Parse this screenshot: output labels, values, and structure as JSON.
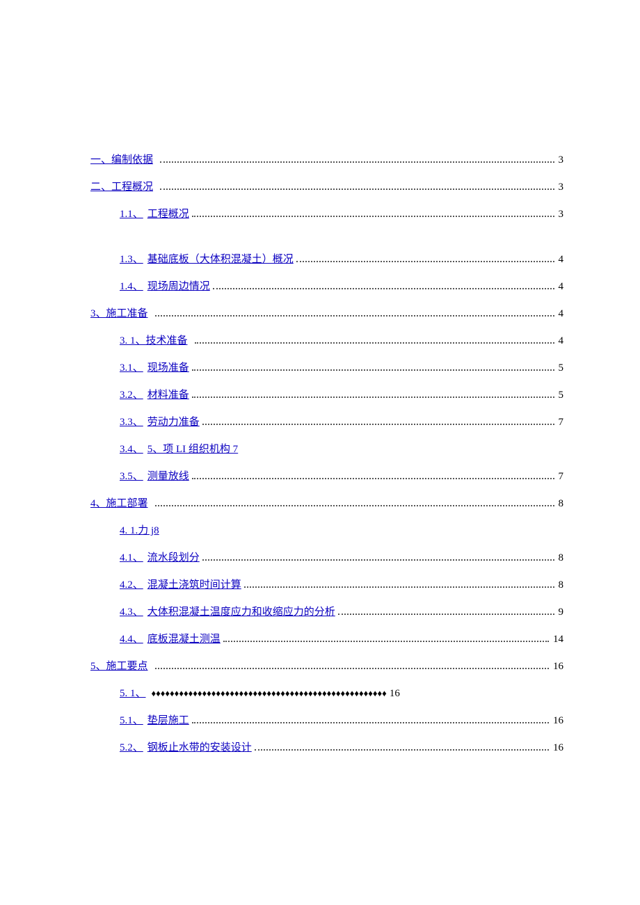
{
  "toc": {
    "items": [
      {
        "label": "一、编制依据",
        "suffix": "",
        "page": "3",
        "indent": false,
        "leader": "dots"
      },
      {
        "label": "二、工程概况",
        "suffix": "",
        "page": "3",
        "indent": false,
        "leader": "dots"
      },
      {
        "label": "1.1、",
        "suffix": "工程概况",
        "page": "3",
        "indent": true,
        "leader": "dots"
      },
      {
        "label": "1.3、",
        "suffix": "基础底板（大体积混凝土）概况",
        "page": "4",
        "indent": true,
        "leader": "dots",
        "space_before": true
      },
      {
        "label": "1.4、",
        "suffix": "现场周边情况",
        "page": "4",
        "indent": true,
        "leader": "dots"
      },
      {
        "label": "3、施工准备",
        "suffix": "",
        "page": "4",
        "indent": false,
        "leader": "dots"
      },
      {
        "label": "3.   1、技术准备",
        "suffix": "",
        "page": "4",
        "indent": true,
        "leader": "dots"
      },
      {
        "label": "3.1、",
        "suffix": "现场准备",
        "page": "5",
        "indent": true,
        "leader": "dots"
      },
      {
        "label": "3.2、",
        "suffix": "材料准备",
        "page": "5",
        "indent": true,
        "leader": "dots"
      },
      {
        "label": "3.3、",
        "suffix": "劳动力准备",
        "page": "7",
        "indent": true,
        "leader": "dots"
      },
      {
        "label": "3.4、",
        "suffix": "5、项 LI 组织机构 7",
        "page": "",
        "indent": true,
        "leader": "none"
      },
      {
        "label": "3.5、",
        "suffix": "测量放线",
        "page": "7",
        "indent": true,
        "leader": "dots"
      },
      {
        "label": "4、施工部署",
        "suffix": "",
        "page": "8",
        "indent": false,
        "leader": "dots"
      },
      {
        "label": "4.   1.力 j8",
        "suffix": "",
        "page": "",
        "indent": true,
        "leader": "none"
      },
      {
        "label": "4.1、",
        "suffix": "流水段划分",
        "page": "8",
        "indent": true,
        "leader": "dots"
      },
      {
        "label": "4.2、",
        "suffix": "混凝土浇筑时间计算",
        "page": "8",
        "indent": true,
        "leader": "dots"
      },
      {
        "label": "4.3、",
        "suffix": "大体积混凝土温度应力和收缩应力的分析",
        "page": "9",
        "indent": true,
        "leader": "dots"
      },
      {
        "label": "4.4、",
        "suffix": "底板混凝土测温",
        "page": "14",
        "indent": true,
        "leader": "dots"
      },
      {
        "label": "5、施工要点",
        "suffix": "",
        "page": "16",
        "indent": false,
        "leader": "dots"
      },
      {
        "label": "5.   1、",
        "suffix": "♦♦♦♦♦♦♦♦♦♦♦♦♦♦♦♦♦♦♦♦♦♦♦♦♦♦♦♦♦♦♦♦♦♦♦♦♦♦♦♦♦♦♦♦♦♦♦♦♦♦♦",
        "page": "16",
        "indent": true,
        "leader": "diamond"
      },
      {
        "label": "5.1、",
        "suffix": "垫层施工",
        "page": "16",
        "indent": true,
        "leader": "dots"
      },
      {
        "label": "5.2、",
        "suffix": "钢板止水带的安装设计",
        "page": "16",
        "indent": true,
        "leader": "dots"
      }
    ]
  }
}
